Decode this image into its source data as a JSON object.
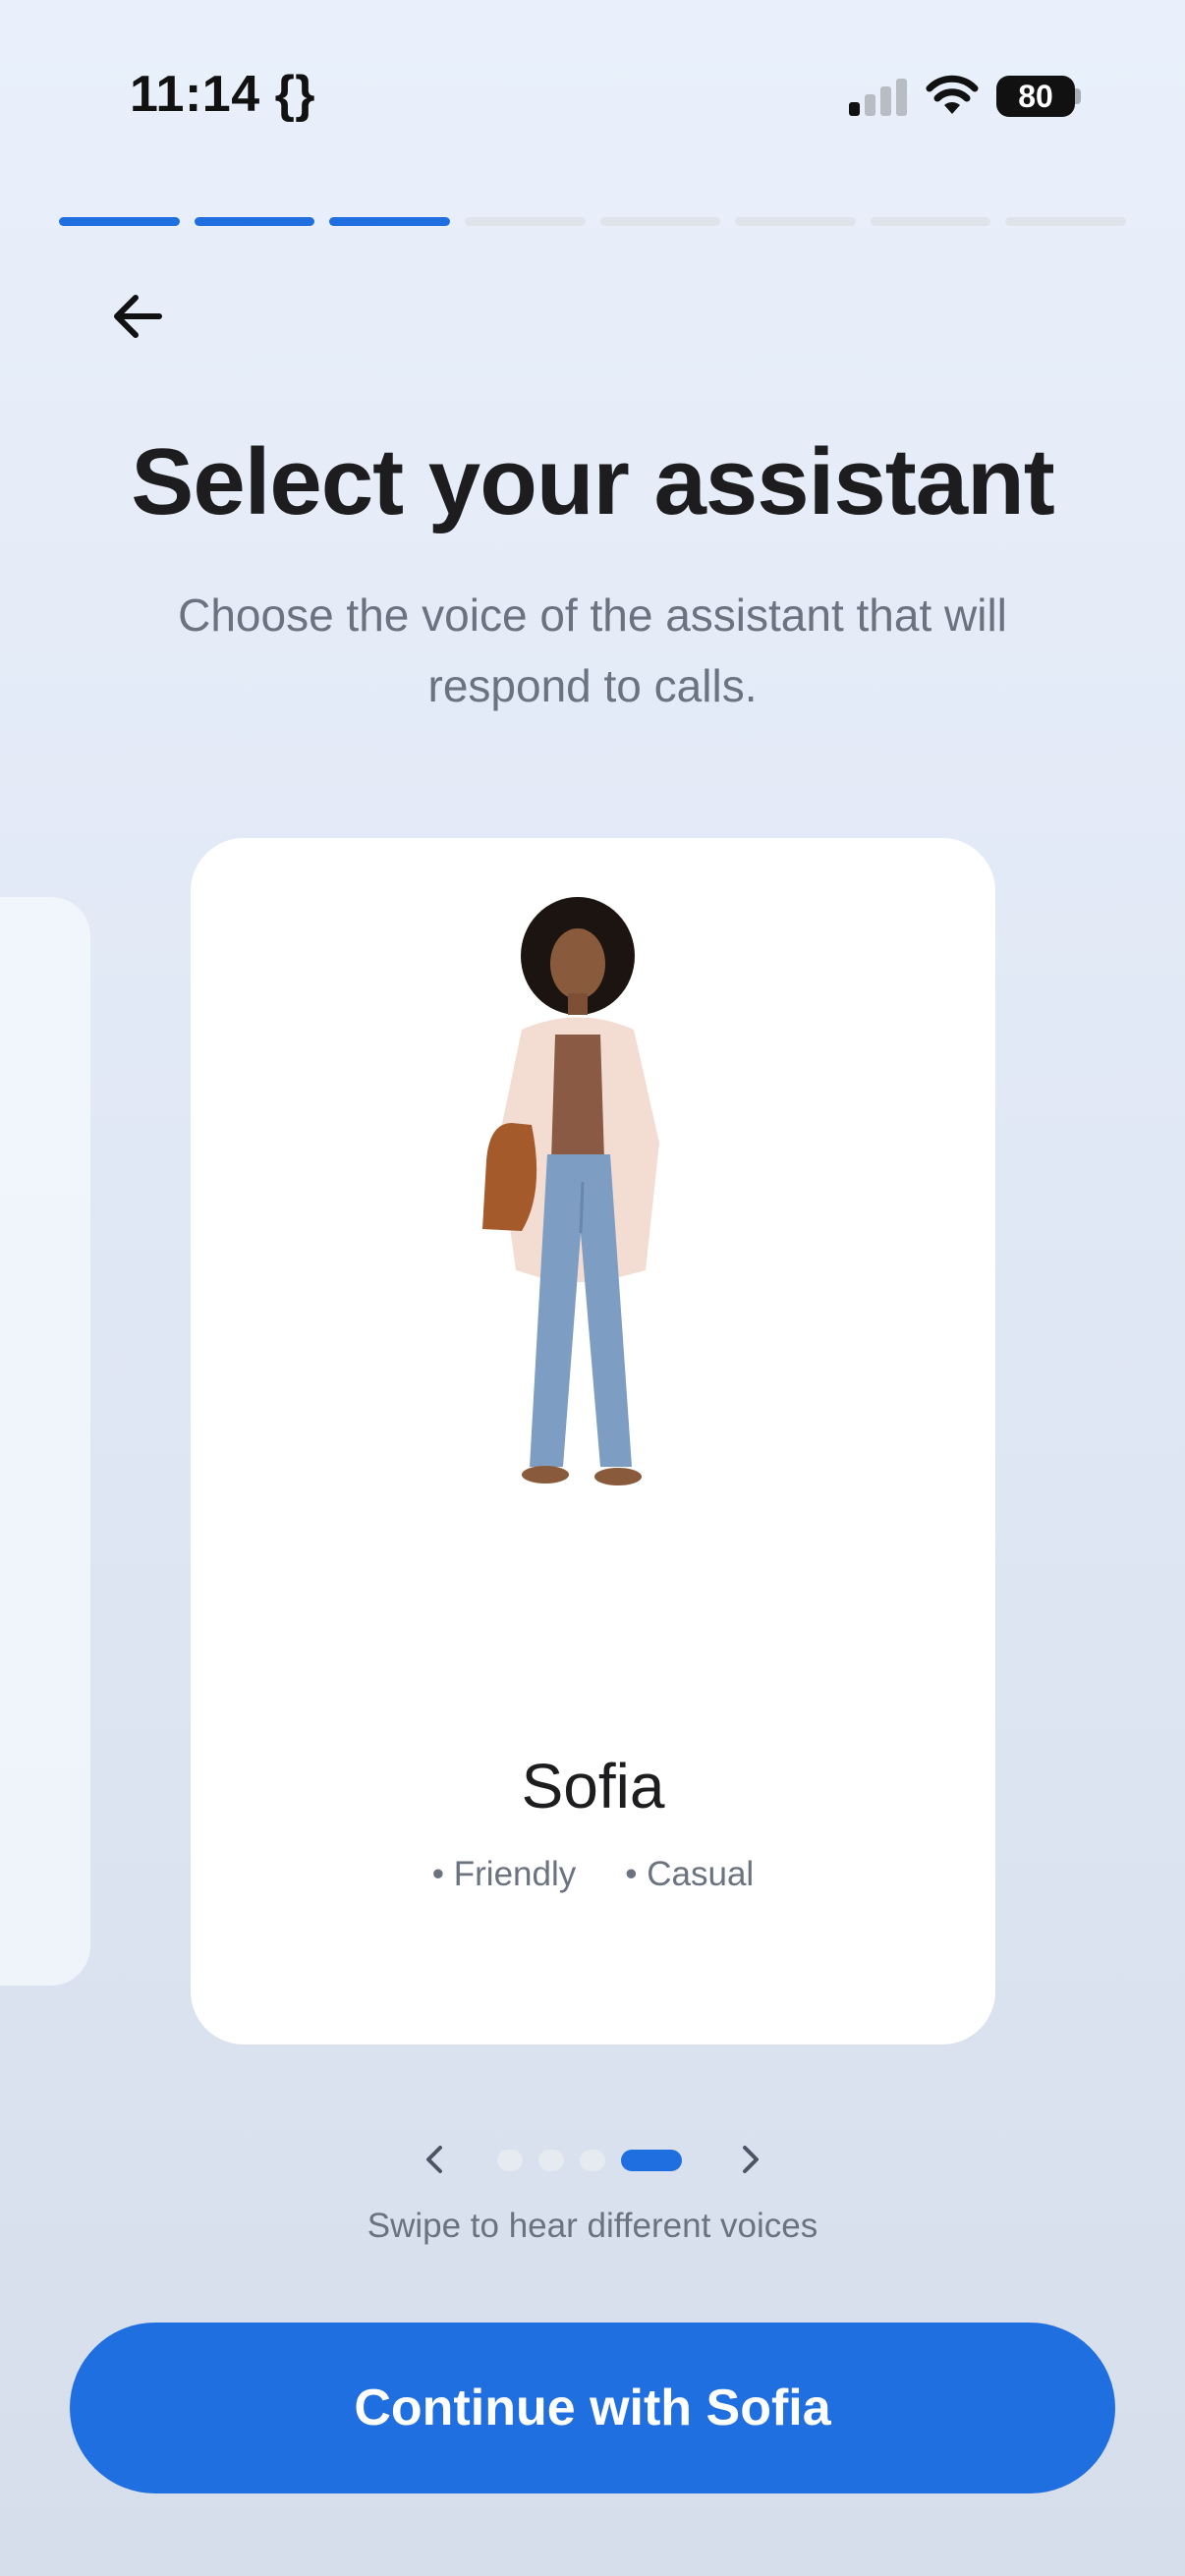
{
  "status": {
    "time": "11:14 {}",
    "battery": "80"
  },
  "progress": {
    "total_steps": 8,
    "completed_steps": 3
  },
  "header": {
    "title": "Select your assistant",
    "subtitle": "Choose the voice of the assistant that will respond to calls."
  },
  "assistant": {
    "name": "Sofia",
    "tags": [
      "• Friendly",
      "• Casual"
    ]
  },
  "carousel": {
    "total": 4,
    "active_index": 3
  },
  "hint": "Swipe to hear different voices",
  "cta_label": "Continue with Sofia",
  "colors": {
    "accent": "#1f6fe0",
    "text": "#1d1d1f",
    "muted": "#6b7280"
  },
  "icons": {
    "back": "arrow-left-icon",
    "prev": "chevron-left-icon",
    "next": "chevron-right-icon"
  }
}
